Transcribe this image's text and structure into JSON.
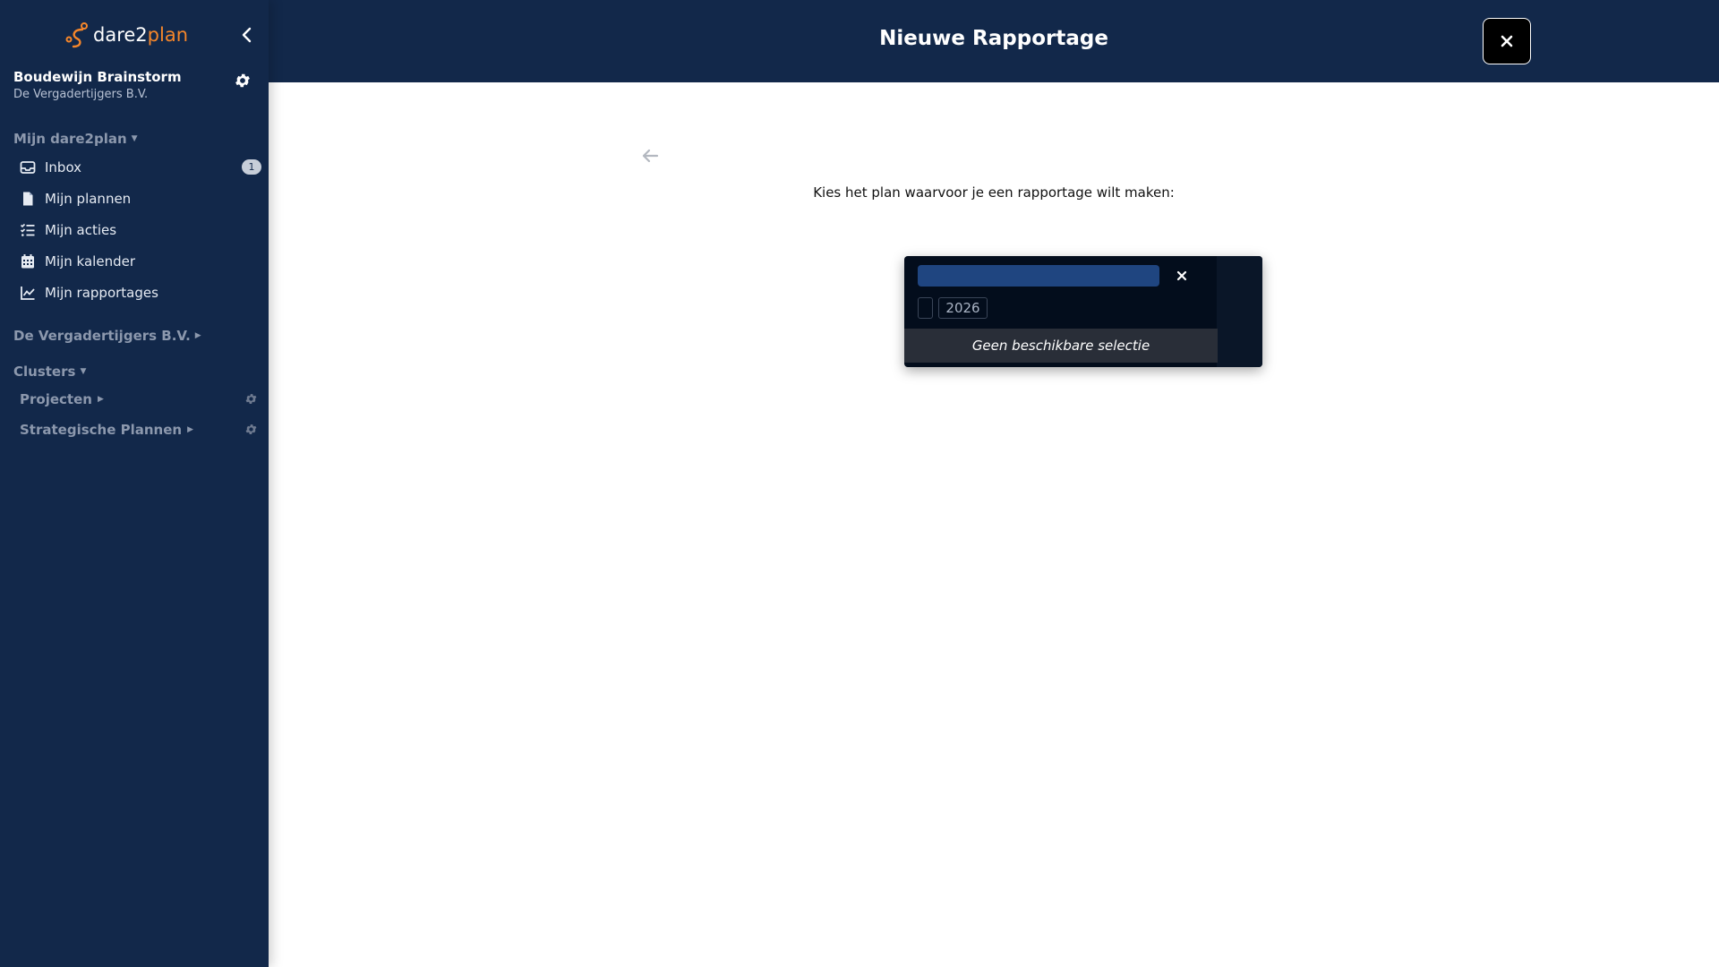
{
  "sidebar": {
    "logo_part1": "dare2",
    "logo_part2": "plan",
    "user_name": "Boudewijn Brainstorm",
    "user_org": "De Vergadertijgers B.V.",
    "section_mijn": "Mijn dare2plan",
    "items": [
      {
        "label": "Inbox",
        "icon": "inbox-icon",
        "badge": "1"
      },
      {
        "label": "Mijn plannen",
        "icon": "file-icon"
      },
      {
        "label": "Mijn acties",
        "icon": "tasks-icon"
      },
      {
        "label": "Mijn kalender",
        "icon": "calendar-icon"
      },
      {
        "label": "Mijn rapportages",
        "icon": "chart-line-icon"
      }
    ],
    "section_org": "De Vergadertijgers B.V.",
    "section_clusters": "Clusters",
    "clusters": [
      {
        "label": "Projecten"
      },
      {
        "label": "Strategische Plannen"
      }
    ]
  },
  "header": {
    "title": "Nieuwe Rapportage"
  },
  "main": {
    "prompt": "Kies het plan waarvoor je een rapportage wilt maken:",
    "picker": {
      "year": "2026",
      "empty_text": "Geen beschikbare selectie"
    }
  },
  "colors": {
    "navy": "#12284a",
    "accent_orange": "#f5862a",
    "input_blue": "#1f4580"
  }
}
